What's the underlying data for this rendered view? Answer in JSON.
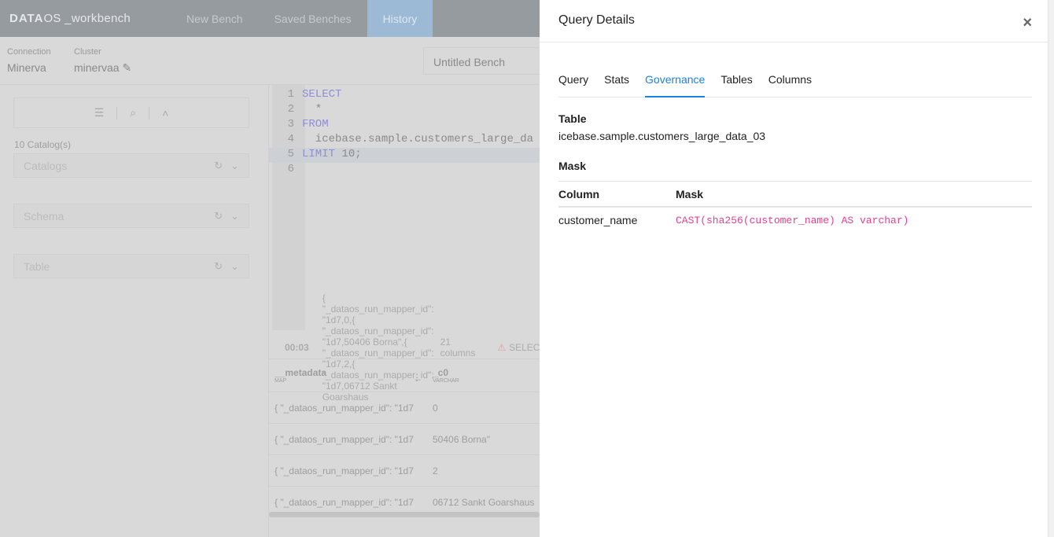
{
  "app": {
    "logo_bold": "DATA",
    "logo_rest": "OS _workbench",
    "nav": [
      "New Bench",
      "Saved Benches",
      "History"
    ],
    "active_nav": "History"
  },
  "connection": {
    "label": "Connection",
    "value": "Minerva"
  },
  "cluster": {
    "label": "Cluster",
    "value": "minervaa"
  },
  "bench_name": "Untitled Bench",
  "sidebar": {
    "catalog_count": "10 Catalog(s)",
    "catalogs_placeholder": "Catalogs",
    "schema_placeholder": "Schema",
    "table_placeholder": "Table"
  },
  "editor": {
    "lines": [
      {
        "n": "1",
        "kw": "SELECT",
        "rest": ""
      },
      {
        "n": "2",
        "kw": "",
        "rest": "  *"
      },
      {
        "n": "3",
        "kw": "FROM",
        "rest": ""
      },
      {
        "n": "4",
        "kw": "",
        "rest": "  icebase.sample.customers_large_da"
      },
      {
        "n": "5",
        "kw": "LIMIT",
        "rest": " 10;"
      },
      {
        "n": "6",
        "kw": "",
        "rest": ""
      }
    ]
  },
  "results": {
    "time": "00:03",
    "rows": [
      [
        "{ \"_dataos_run_mapper_id\": \"1d7",
        "0"
      ],
      [
        "{ \"_dataos_run_mapper_id\": \"1d7",
        "50406 Borna\""
      ],
      [
        "{ \"_dataos_run_mapper_id\": \"1d7",
        "2"
      ],
      [
        "{ \"_dataos_run_mapper_id\": \"1d7",
        "06712 Sankt Goarshaus"
      ]
    ],
    "columns": "21 columns",
    "warning": "SELECT * FRO",
    "headers": [
      {
        "name": "__metadata",
        "type": "MAP"
      },
      {
        "name": "_c0",
        "type": "VARCHAR"
      }
    ]
  },
  "panel": {
    "title": "Query Details",
    "tabs": [
      "Query",
      "Stats",
      "Governance",
      "Tables",
      "Columns"
    ],
    "active_tab": "Governance",
    "table_heading": "Table",
    "table_value": "icebase.sample.customers_large_data_03",
    "mask_heading": "Mask",
    "mask_headers": [
      "Column",
      "Mask"
    ],
    "mask_rows": [
      [
        "customer_name",
        "CAST(sha256(customer_name) AS varchar)"
      ]
    ]
  },
  "colors": {
    "accent": "#1a82e2",
    "mask_code": "#e83e8c"
  }
}
